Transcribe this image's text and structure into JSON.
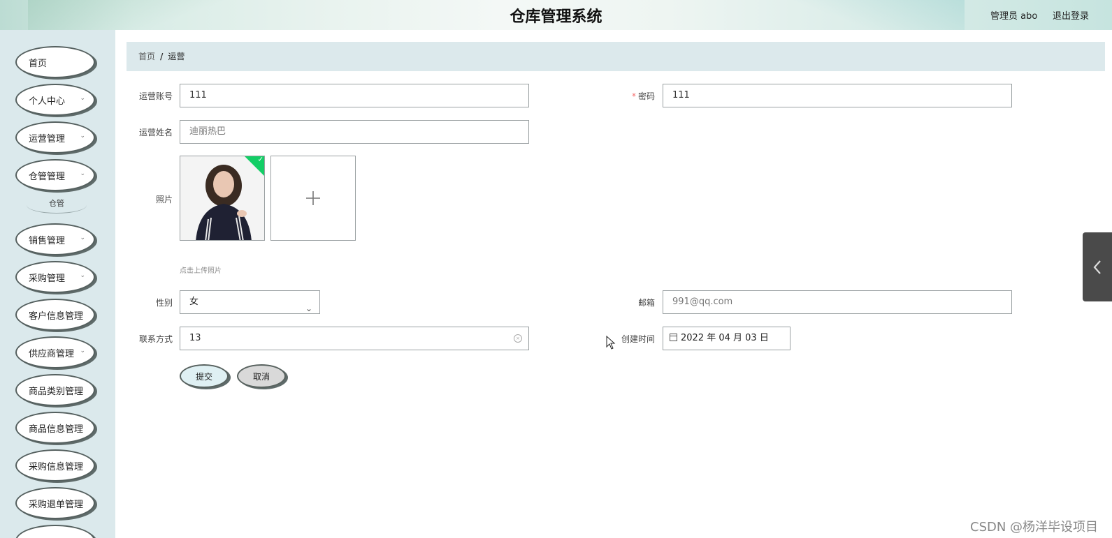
{
  "header": {
    "title": "仓库管理系统",
    "user": "管理员 abo",
    "logout": "退出登录"
  },
  "sidebar": {
    "items": [
      {
        "label": "首页",
        "has_children": false
      },
      {
        "label": "个人中心",
        "has_children": true
      },
      {
        "label": "运营管理",
        "has_children": true
      },
      {
        "label": "仓管管理",
        "has_children": true
      },
      {
        "label": "销售管理",
        "has_children": true
      },
      {
        "label": "采购管理",
        "has_children": true
      },
      {
        "label": "客户信息管理",
        "has_children": false
      },
      {
        "label": "供应商管理",
        "has_children": true
      },
      {
        "label": "商品类别管理",
        "has_children": false
      },
      {
        "label": "商品信息管理",
        "has_children": false
      },
      {
        "label": "采购信息管理",
        "has_children": false
      },
      {
        "label": "采购退单管理",
        "has_children": false
      }
    ],
    "sub_item": "仓管",
    "chevron_icon": "chevron-down-icon"
  },
  "breadcrumb": {
    "home": "首页",
    "separator": "/",
    "current": "运营"
  },
  "form": {
    "account": {
      "label": "运营账号",
      "value": "111"
    },
    "password": {
      "label": "密码",
      "required_mark": "*",
      "value": "111"
    },
    "name": {
      "label": "运营姓名",
      "value": "迪丽热巴"
    },
    "photo": {
      "label": "照片",
      "tip": "点击上传照片",
      "uploaded_icon": "check-icon",
      "add_icon": "plus-icon"
    },
    "gender": {
      "label": "性别",
      "value": "女"
    },
    "email": {
      "label": "邮箱",
      "value": "991@qq.com"
    },
    "phone": {
      "label": "联系方式",
      "value": "13"
    },
    "created": {
      "label": "创建时间",
      "value": "2022 年 04 月 03 日"
    },
    "submit": "提交",
    "cancel": "取消"
  },
  "watermark": "CSDN @杨洋毕设项目",
  "colors": {
    "sidebar_bg": "#dbe9ec",
    "breadcrumb_bg": "#dce9ec",
    "required": "#f56c6c",
    "success": "#13ce66"
  }
}
